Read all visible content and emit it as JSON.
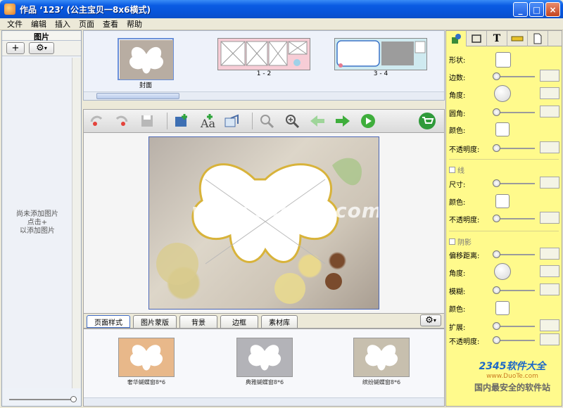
{
  "window": {
    "title": "作品 ‘123’ (公主宝贝一8x6横式)",
    "minimize": "_",
    "maximize": "□",
    "close": "×"
  },
  "menu": [
    "文件",
    "编辑",
    "插入",
    "页面",
    "查看",
    "帮助"
  ],
  "left_panel": {
    "header": "图片",
    "add_button": "+",
    "settings_button": "⚙",
    "empty_text": [
      "尚未添加图片",
      "点击+",
      "以添加图片"
    ]
  },
  "pages": [
    {
      "label": "封面"
    },
    {
      "label": "1 - 2"
    },
    {
      "label": "3 - 4"
    }
  ],
  "canvas": {
    "watermark": "www.DuoTe.com"
  },
  "bottom_tabs": [
    "页面样式",
    "图片蒙版",
    "背景",
    "边框",
    "素材库"
  ],
  "styles": [
    {
      "label": "奢华蝴蝶窗8*6",
      "bg": "#e8b88a"
    },
    {
      "label": "典雅蝴蝶窗8*6",
      "bg": "#b3b3b8"
    },
    {
      "label": "缤纷蝴蝶窗8*6",
      "bg": "#c7bfae"
    }
  ],
  "properties": {
    "shape": "形状:",
    "edges": "边数:",
    "angle": "角度:",
    "radius": "圆角:",
    "color": "颜色:",
    "opacity": "不透明度:",
    "line_section": "线",
    "size": "尺寸:",
    "line_color": "颜色:",
    "line_opacity": "不透明度:",
    "shadow_section": "阴影",
    "offset": "偏移距离:",
    "shadow_angle": "角度:",
    "blur": "模糊:",
    "shadow_color": "颜色:",
    "spread": "扩展:",
    "shadow_opacity": "不透明度:"
  },
  "watermark_logo": {
    "brand": "2345软件大全",
    "url": "www.DuoTe.com",
    "slogan": "国内最安全的软件站"
  }
}
